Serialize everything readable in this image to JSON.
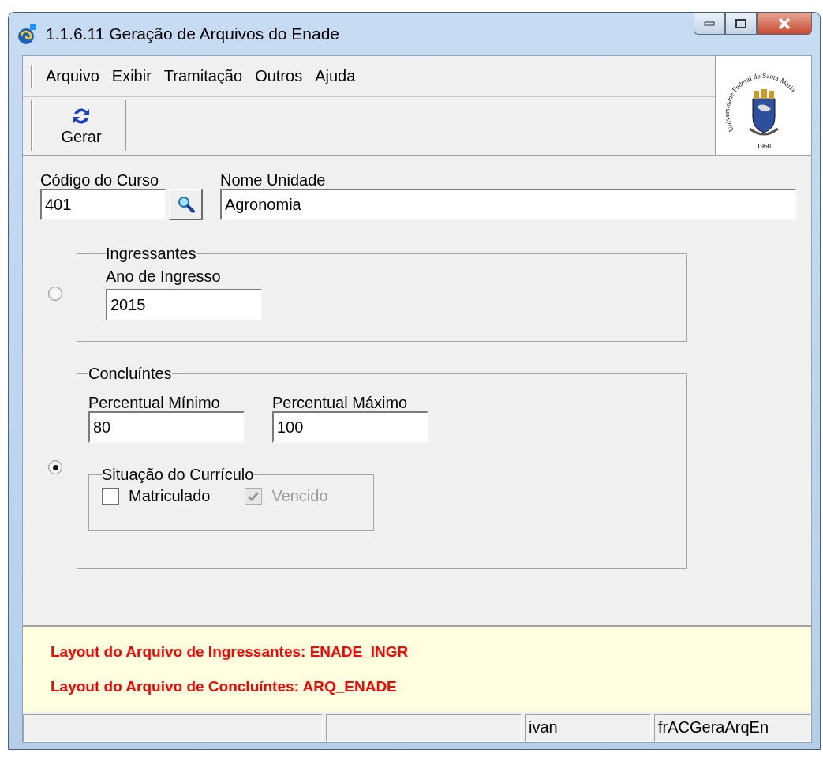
{
  "window": {
    "title": "1.1.6.11 Geração de Arquivos do Enade"
  },
  "menu": [
    {
      "label": "Arquivo"
    },
    {
      "label": "Exibir"
    },
    {
      "label": "Tramitação"
    },
    {
      "label": "Outros"
    },
    {
      "label": "Ajuda"
    }
  ],
  "toolbar": [
    {
      "label": "Gerar"
    }
  ],
  "logo": {
    "text": "Universidade Federal de Santa Maria",
    "year": "1960"
  },
  "codigo_curso": {
    "label": "Código do Curso",
    "value": "401"
  },
  "nome_unidade": {
    "label": "Nome Unidade",
    "value": "Agronomia"
  },
  "ingressantes": {
    "selected": false,
    "legend": "Ingressantes",
    "ano_ingresso": {
      "label": "Ano de Ingresso",
      "value": "2015"
    }
  },
  "concluintes": {
    "selected": true,
    "legend": "Concluíntes",
    "percentual_minimo": {
      "label": "Percentual Mínimo",
      "value": "80"
    },
    "percentual_maximo": {
      "label": "Percentual Máximo",
      "value": "100"
    },
    "situacao": {
      "legend": "Situação do Currículo",
      "options": [
        {
          "label": "Matriculado",
          "checked": false,
          "disabled": false
        },
        {
          "label": "Vencido",
          "checked": true,
          "disabled": true
        }
      ]
    }
  },
  "info": [
    "Layout do Arquivo de Ingressantes:  ENADE_INGR",
    "Layout do Arquivo de Concluíntes:  ARQ_ENADE"
  ],
  "status_bar": [
    "ivan",
    "frACGeraArqEn"
  ]
}
